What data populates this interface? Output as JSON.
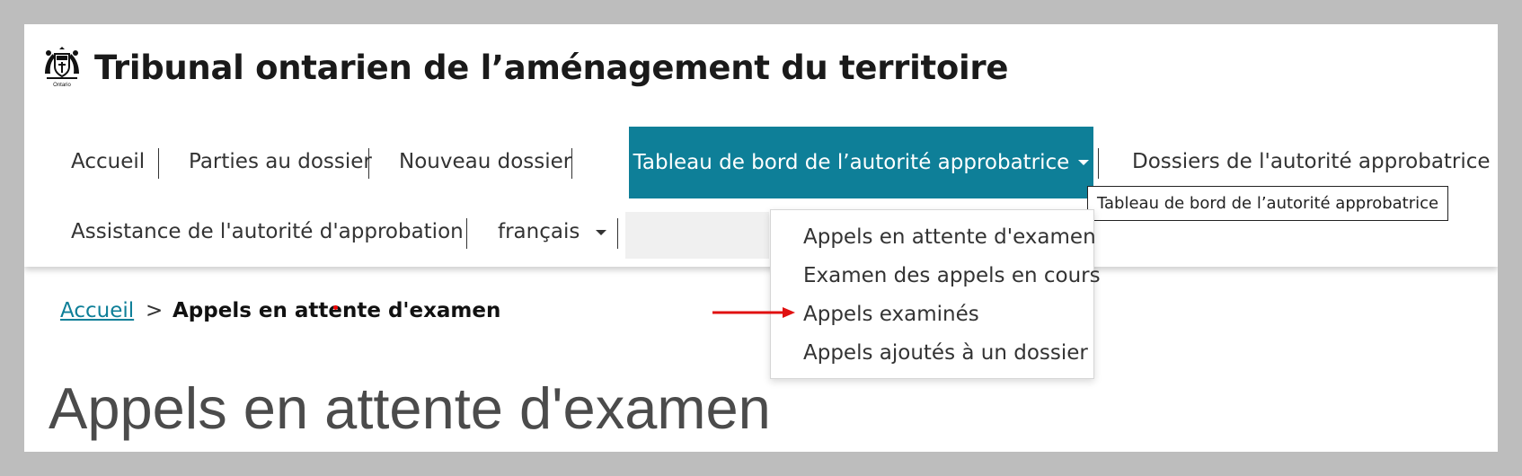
{
  "header": {
    "site_title": "Tribunal ontarien de l’aménagement du territoire",
    "logo_name": "ontario-coat-of-arms"
  },
  "nav": {
    "items": [
      {
        "label": "Accueil"
      },
      {
        "label": "Parties au dossier"
      },
      {
        "label": "Nouveau dossier"
      },
      {
        "label": "Tableau de bord de l’autorité approbatrice",
        "active": true
      },
      {
        "label": "Dossiers de l'autorité approbatrice"
      },
      {
        "label": "Assistance de l'autorité d'approbation"
      },
      {
        "label": "français"
      }
    ],
    "active_color": "#0e7f98"
  },
  "tooltip": {
    "text": "Tableau de bord de l’autorité approbatrice"
  },
  "dropdown": {
    "items": [
      {
        "label": "Appels en attente d'examen"
      },
      {
        "label": "Examen des appels en cours"
      },
      {
        "label": "Appels examinés"
      },
      {
        "label": "Appels ajoutés à un dossier"
      }
    ]
  },
  "breadcrumb": {
    "home": "Accueil",
    "separator": ">",
    "current": "Appels en attente d'examen"
  },
  "page": {
    "title": "Appels en attente d'examen"
  },
  "annotations": {
    "arrow_color": "#e01010"
  }
}
